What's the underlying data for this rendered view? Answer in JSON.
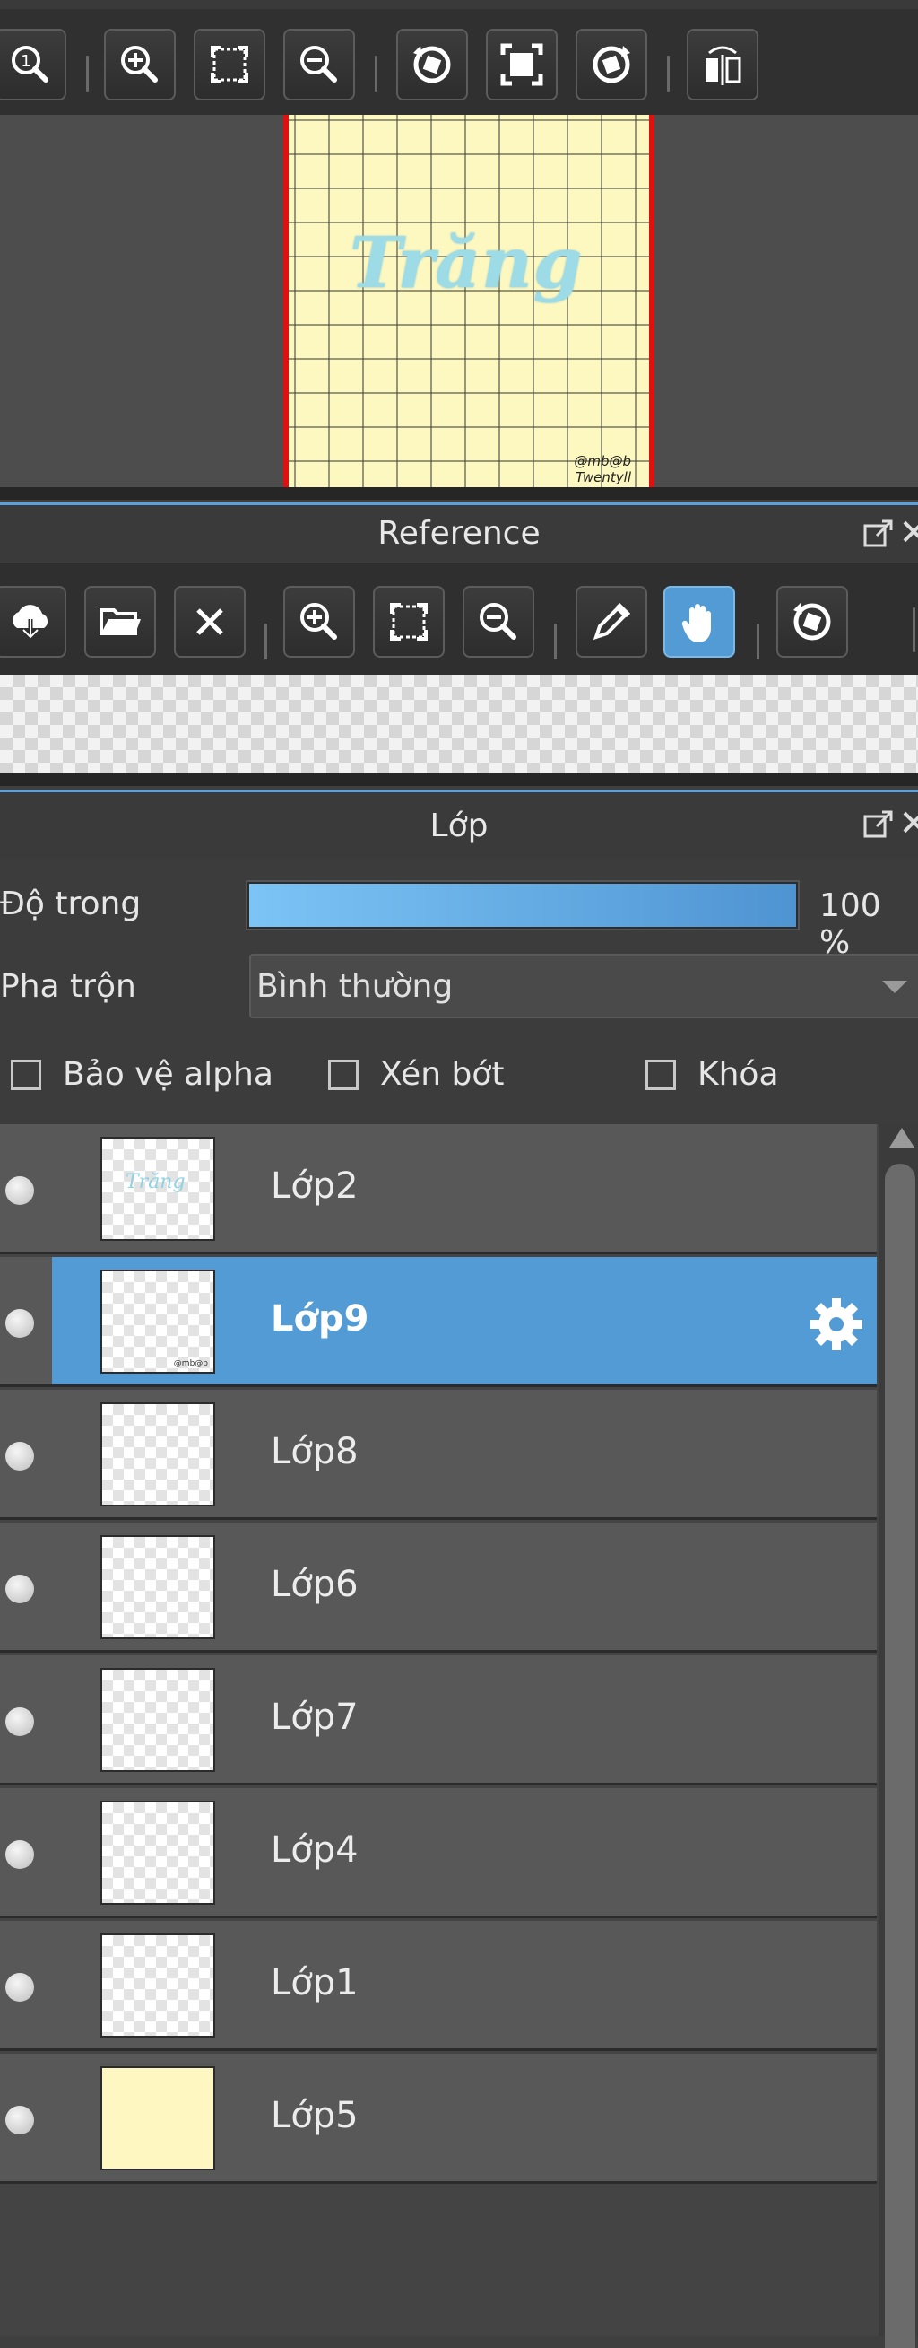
{
  "navigator": {
    "tools": [
      {
        "name": "zoom-actual-icon",
        "label": "1"
      },
      {
        "name": "zoom-in-icon"
      },
      {
        "name": "fit-screen-icon"
      },
      {
        "name": "zoom-out-icon"
      },
      {
        "name": "rotate-left-icon"
      },
      {
        "name": "fill-screen-icon"
      },
      {
        "name": "rotate-right-icon"
      },
      {
        "name": "flip-horizontal-icon"
      }
    ],
    "canvas_text": "Trăng",
    "canvas_signature_line1": "@mb@b",
    "canvas_signature_line2": "Twentyll"
  },
  "reference": {
    "title": "Reference",
    "tools": [
      "cloud-download-icon",
      "folder-open-icon",
      "close-icon",
      "zoom-in-icon",
      "fit-screen-icon",
      "zoom-out-icon",
      "eyedropper-icon",
      "hand-icon",
      "rotate-icon"
    ]
  },
  "layers": {
    "title": "Lớp",
    "opacity_label": "Độ trong",
    "opacity_value": "100 %",
    "opacity_fraction": 1.0,
    "blend_label": "Pha trộn",
    "blend_value": "Bình thường",
    "protect_alpha_label": "Bảo vệ alpha",
    "clipping_label": "Xén bớt",
    "lock_label": "Khóa",
    "items": [
      {
        "name": "Lớp2",
        "thumb": "text"
      },
      {
        "name": "Lớp9",
        "thumb": "sig",
        "selected": true
      },
      {
        "name": "Lớp8",
        "thumb": "empty"
      },
      {
        "name": "Lớp6",
        "thumb": "empty"
      },
      {
        "name": "Lớp7",
        "thumb": "empty"
      },
      {
        "name": "Lớp4",
        "thumb": "empty"
      },
      {
        "name": "Lớp1",
        "thumb": "empty"
      },
      {
        "name": "Lớp5",
        "thumb": "fill"
      }
    ]
  },
  "colors": {
    "accent": "#539bd4",
    "paper": "#fdf7c0",
    "canvas_border": "#e01010"
  }
}
